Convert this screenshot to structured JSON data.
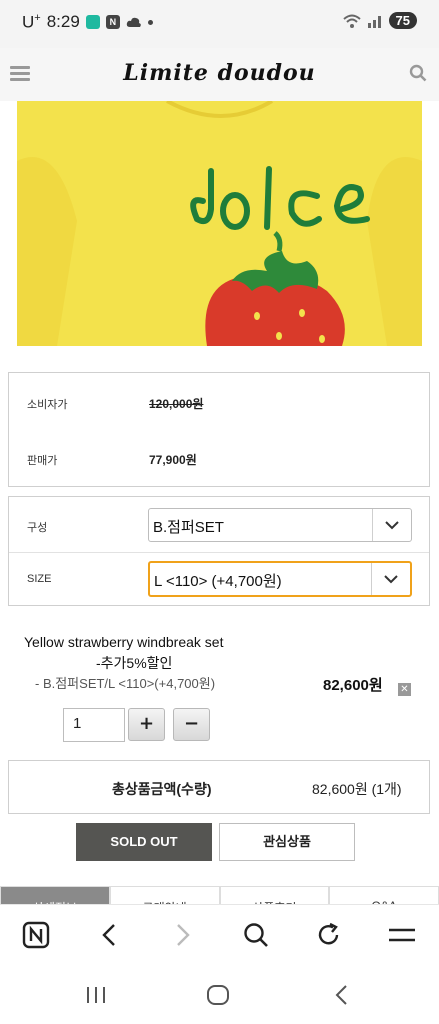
{
  "status_bar": {
    "carrier": "U",
    "carrier_sup": "+",
    "time": "8:29",
    "battery": "75"
  },
  "header": {
    "logo": "Limite doudou"
  },
  "price": {
    "consumer_label": "소비자가",
    "consumer_value": "120,000원",
    "sale_label": "판매가",
    "sale_value": "77,900원"
  },
  "options": {
    "composition_label": "구성",
    "composition_value": "B.점퍼SET",
    "size_label": "SIZE",
    "size_value": "L <110> (+4,700원)"
  },
  "selected_item": {
    "name": "Yellow strawberry windbreak set",
    "discount": "-추가5%할인",
    "option": "- B.점퍼SET/L <110>(+4,700원)",
    "price": "82,600원",
    "remove": "✕",
    "quantity": "1",
    "plus": "+",
    "minus": "−"
  },
  "total": {
    "label": "총상품금액(수량)",
    "value": "82,600원 (1개)"
  },
  "actions": {
    "soldout": "SOLD OUT",
    "wishlist": "관심상품"
  },
  "detail_tabs": [
    "상세정보",
    "구매안내",
    "상품후기",
    "Q&A"
  ],
  "browser_bar": {
    "icons": [
      "naver-icon",
      "back-icon",
      "forward-icon",
      "search-icon",
      "refresh-icon",
      "menu-icon"
    ]
  },
  "colors": {
    "select_focus": "#f0a21a",
    "soldout_bg": "#555552",
    "product_bg": "#f2e04a"
  }
}
